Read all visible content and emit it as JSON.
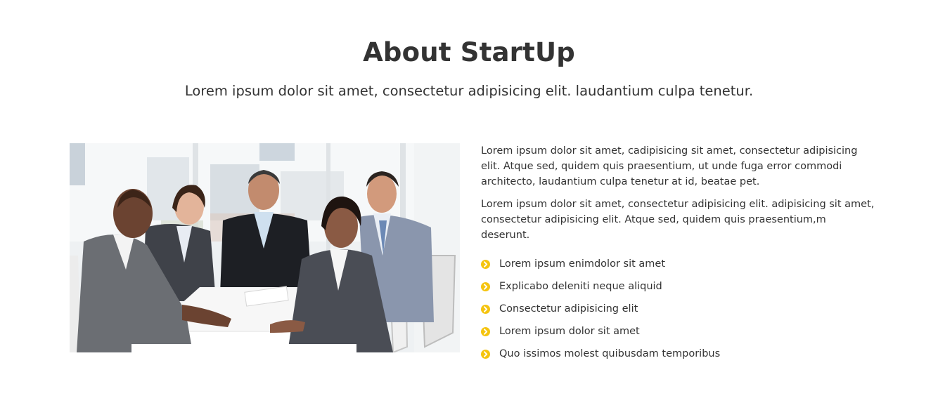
{
  "about": {
    "title": "About StartUp",
    "subtitle": "Lorem ipsum dolor sit amet, consectetur adipisicing elit. laudantium culpa tenetur.",
    "paragraph_1": "Lorem ipsum dolor sit amet, cadipisicing sit amet, consectetur adipisicing elit. Atque sed, quidem quis praesentium, ut unde fuga error commodi architecto, laudantium culpa tenetur at id, beatae pet.",
    "paragraph_2": "Lorem ipsum dolor sit amet, consectetur adipisicing elit. adipisicing sit amet, consectetur adipisicing elit. Atque sed, quidem quis praesentium,m deserunt.",
    "features": [
      "Lorem ipsum enimdolor sit amet",
      "Explicabo deleniti neque aliquid",
      "Consectetur adipisicing elit",
      "Lorem ipsum dolor sit amet",
      "Quo issimos molest quibusdam temporibus"
    ],
    "bullet_icon": "chevron-circle-right-icon"
  },
  "colors": {
    "accent": "#f5c40f",
    "text": "#333333",
    "background": "#ffffff"
  }
}
